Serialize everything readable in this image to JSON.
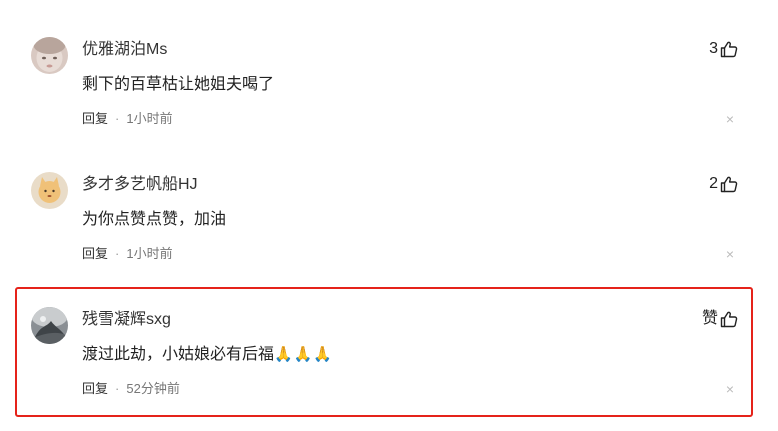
{
  "comments": [
    {
      "username": "优雅湖泊Ms",
      "likes": "3",
      "content": "剩下的百草枯让她姐夫喝了",
      "reply_label": "回复",
      "separator": "·",
      "time": "1小时前",
      "close": "×"
    },
    {
      "username": "多才多艺帆船HJ",
      "likes": "2",
      "content": "为你点赞点赞，加油",
      "reply_label": "回复",
      "separator": "·",
      "time": "1小时前",
      "close": "×"
    },
    {
      "username": "残雪凝辉sxg",
      "likes": "赞",
      "content": "渡过此劫，小姑娘必有后福",
      "emoji": "🙏🙏🙏",
      "reply_label": "回复",
      "separator": "·",
      "time": "52分钟前",
      "close": "×"
    }
  ],
  "colors": {
    "highlight_border": "#e5231a",
    "meta_text": "#777777",
    "close_icon": "#bbbbbb"
  }
}
